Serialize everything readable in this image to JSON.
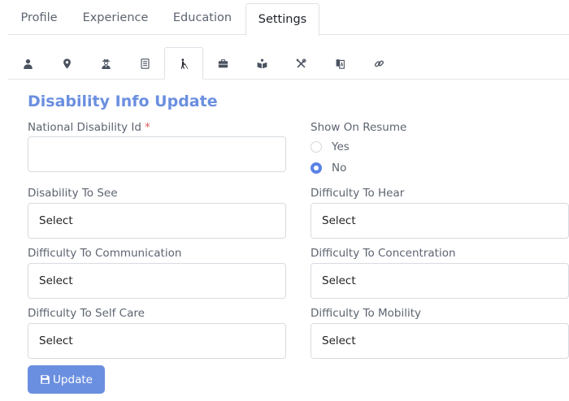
{
  "top_tabs": [
    {
      "label": "Profile"
    },
    {
      "label": "Experience"
    },
    {
      "label": "Education"
    },
    {
      "label": "Settings",
      "active": true
    }
  ],
  "icon_tabs": [
    {
      "icon": "user-icon"
    },
    {
      "icon": "map-marker-icon"
    },
    {
      "icon": "user-secret-icon"
    },
    {
      "icon": "document-icon"
    },
    {
      "icon": "blind-person-icon",
      "active": true
    },
    {
      "icon": "briefcase-icon"
    },
    {
      "icon": "book-reader-icon"
    },
    {
      "icon": "tools-icon"
    },
    {
      "icon": "language-book-icon"
    },
    {
      "icon": "link-icon"
    }
  ],
  "form": {
    "title": "Disability Info Update",
    "national_id_label": "National Disability Id",
    "national_id_required_mark": "*",
    "national_id_value": "",
    "show_on_resume_label": "Show On Resume",
    "radio_yes": "Yes",
    "radio_no": "No",
    "selected_option": "No",
    "disability_to_see_label": "Disability To See",
    "disability_to_see_value": "Select",
    "difficulty_to_hear_label": "Difficulty To Hear",
    "difficulty_to_hear_value": "Select",
    "difficulty_to_communication_label": "Difficulty To Communication",
    "difficulty_to_communication_value": "Select",
    "difficulty_to_concentration_label": "Difficulty To Concentration",
    "difficulty_to_concentration_value": "Select",
    "difficulty_to_self_care_label": "Difficulty To Self Care",
    "difficulty_to_self_care_value": "Select",
    "difficulty_to_mobility_label": "Difficulty To Mobility",
    "difficulty_to_mobility_value": "Select",
    "update_button": "Update"
  },
  "colors": {
    "accent": "#6b8fe0",
    "radio_checked": "#5b83e6",
    "required": "#e05a5a",
    "icon": "#4a5260"
  }
}
